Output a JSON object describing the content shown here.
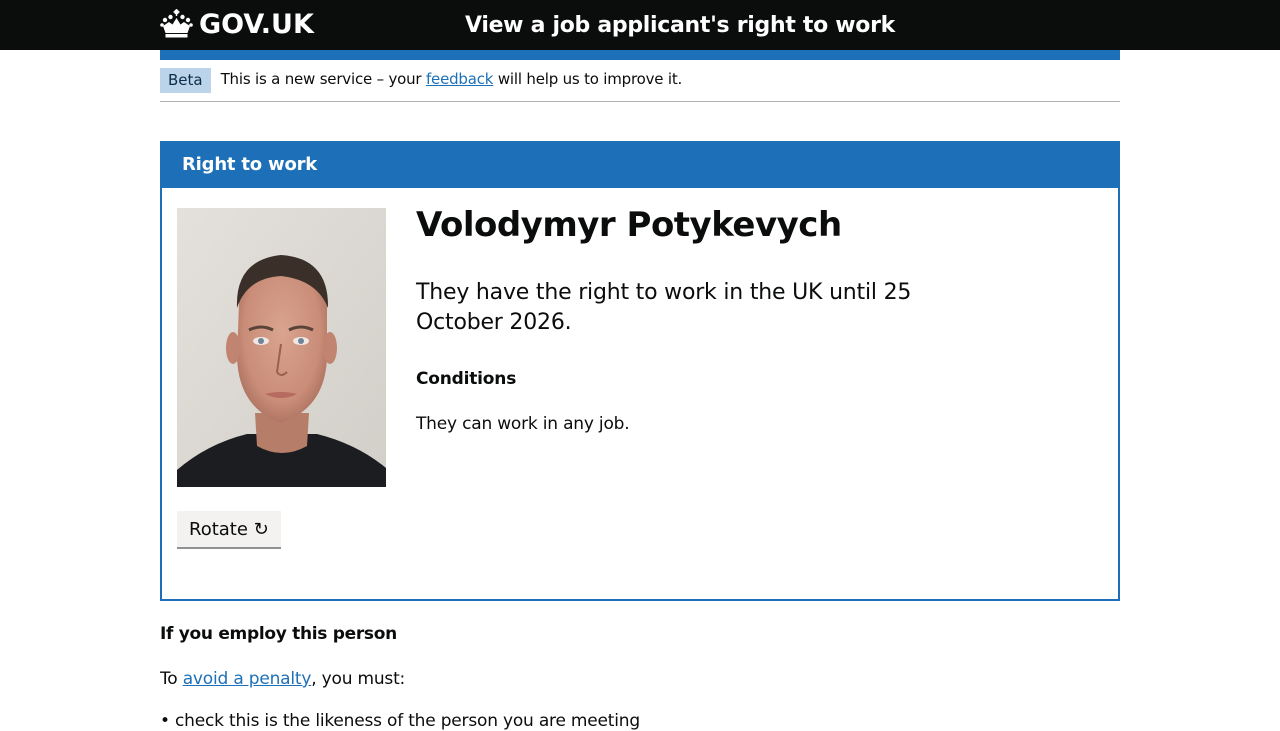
{
  "header": {
    "logo_text": "GOV.UK",
    "service_name": "View a job applicant's right to work"
  },
  "phase_banner": {
    "tag": "Beta",
    "text_before": "This is a new service – your",
    "link": "feedback",
    "text_after": "will help us to improve it."
  },
  "card": {
    "title": "Right to work",
    "name": "Volodymyr Potykevych",
    "status": "They have the right to work in the UK until 25 October 2026.",
    "conditions_heading": "Conditions",
    "conditions_text": "They can work in any job.",
    "rotate_label": "Rotate ↻"
  },
  "employ": {
    "heading": "If you employ this person",
    "text_before": "To",
    "link": "avoid a penalty",
    "text_after": ", you must:",
    "first_item": "• check this is the likeness of the person you are meeting"
  },
  "colors": {
    "header_bg": "#0b0c0c",
    "brand_blue": "#1d70b8",
    "beta_tag_bg": "#bbd4ea",
    "button_bg": "#f3f2f1"
  }
}
